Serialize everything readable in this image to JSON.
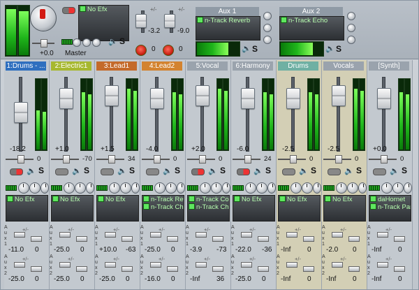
{
  "master": {
    "label": "Master",
    "gain": "+0.0",
    "fx": [
      "No Efx"
    ],
    "s_label": "S"
  },
  "aux_returns": [
    {
      "title": "Aux 1",
      "fx": [
        "n-Track Reverb"
      ],
      "gain_left": "-3.2",
      "pan_value": "0"
    },
    {
      "title": "Aux 2",
      "fx": [
        "n-Track Echo"
      ],
      "gain_left": "-9.0",
      "pan_value": "0"
    }
  ],
  "aux_marks": [
    "+/-",
    "+/-"
  ],
  "channels": [
    {
      "name": "1:Drums - ...",
      "color": "#2f6fbf",
      "gain": "-18.2",
      "right": "0",
      "fx": [
        "No Efx"
      ],
      "aux1_gain": "-11.0",
      "aux1_right": "0",
      "aux2_gain": "-25.0",
      "aux2_right": "0",
      "fill": 0.55
    },
    {
      "name": "2:Electric1",
      "color": "#a7b82f",
      "gain": "+1.0",
      "right": "-70",
      "fx": [
        "No Efx"
      ],
      "aux1_gain": "-25.0",
      "aux1_right": "0",
      "aux2_gain": "-25.0",
      "aux2_right": "0",
      "fill": 0.8
    },
    {
      "name": "3:Lead1",
      "color": "#c46a2a",
      "gain": "+1.5",
      "right": "34",
      "fx": [
        "No Efx"
      ],
      "aux1_gain": "+10.0",
      "aux1_right": "-63",
      "aux2_gain": "-25.0",
      "aux2_right": "0",
      "fill": 0.85
    },
    {
      "name": "4:Lead2",
      "color": "#d3832f",
      "gain": "-4.0",
      "right": "0",
      "fx": [
        "n-Track Rev",
        "n-Track Cho"
      ],
      "aux1_gain": "-25.0",
      "aux1_right": "0",
      "aux2_gain": "-16.0",
      "aux2_right": "0",
      "fill": 0.8
    },
    {
      "name": "5:Vocal",
      "color": "#9aa3ad",
      "gain": "+2.0",
      "right": "0",
      "fx": [
        "n-Track Com",
        "n-Track Cho"
      ],
      "aux1_gain": "-3.9",
      "aux1_right": "-73",
      "aux2_gain": "-Inf",
      "aux2_right": "36",
      "fill": 0.85
    },
    {
      "name": "6:Harmony",
      "color": "#9aa3ad",
      "gain": "-6.0",
      "right": "24",
      "fx": [
        "No Efx"
      ],
      "aux1_gain": "-22.0",
      "aux1_right": "-36",
      "aux2_gain": "-25.0",
      "aux2_right": "0",
      "fill": 0.8
    },
    {
      "name": "Drums",
      "color": "#6fb0a3",
      "gain": "-2.5",
      "right": "0",
      "fx": [
        "No Efx"
      ],
      "aux1_gain": "-Inf",
      "aux1_right": "0",
      "aux2_gain": "-Inf",
      "aux2_right": "0",
      "fill": 0.8
    },
    {
      "name": "Vocals",
      "color": "#9aa3ad",
      "gain": "-2.5",
      "right": "0",
      "fx": [
        "No Efx"
      ],
      "aux1_gain": "-2.0",
      "aux1_right": "0",
      "aux2_gain": "-Inf",
      "aux2_right": "0",
      "fill": 0.85
    },
    {
      "name": "[Synth]",
      "color": "#9aa3ad",
      "gain": "+0.0",
      "right": "0",
      "fx": [
        "daHornet",
        "n-Track Para"
      ],
      "aux1_gain": "-Inf",
      "aux1_right": "0",
      "aux2_gain": "-Inf",
      "aux2_right": "0",
      "fill": 0.8
    }
  ],
  "aux_side_labels": [
    "A",
    "u",
    "x",
    "1",
    "A",
    "u",
    "x",
    "2"
  ],
  "s_label": "S"
}
